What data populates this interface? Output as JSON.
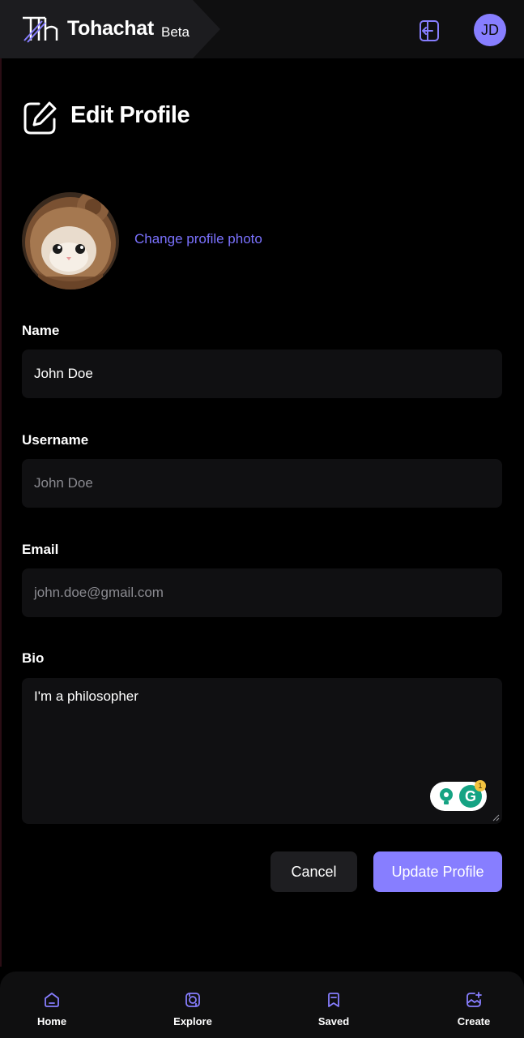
{
  "app": {
    "name": "Tohachat",
    "badge": "Beta",
    "accent": "#877eff"
  },
  "header": {
    "logout_icon": "logout-icon",
    "avatar_initials": "JD"
  },
  "page": {
    "title": "Edit Profile",
    "title_icon": "edit-icon"
  },
  "profile": {
    "photo_icon": "cat-avatar-photo",
    "change_photo_label": "Change profile photo"
  },
  "form": {
    "name": {
      "label": "Name",
      "value": "John Doe"
    },
    "username": {
      "label": "Username",
      "placeholder": "John Doe"
    },
    "email": {
      "label": "Email",
      "placeholder": "john.doe@gmail.com"
    },
    "bio": {
      "label": "Bio",
      "value": "I'm a philosopher"
    },
    "grammarly": {
      "badge_count": "1",
      "icon": "grammarly-icon"
    }
  },
  "actions": {
    "cancel_label": "Cancel",
    "update_label": "Update Profile"
  },
  "bottom_nav": {
    "items": [
      {
        "label": "Home",
        "icon": "home-icon"
      },
      {
        "label": "Explore",
        "icon": "explore-icon"
      },
      {
        "label": "Saved",
        "icon": "bookmark-icon"
      },
      {
        "label": "Create",
        "icon": "create-post-icon"
      }
    ]
  }
}
